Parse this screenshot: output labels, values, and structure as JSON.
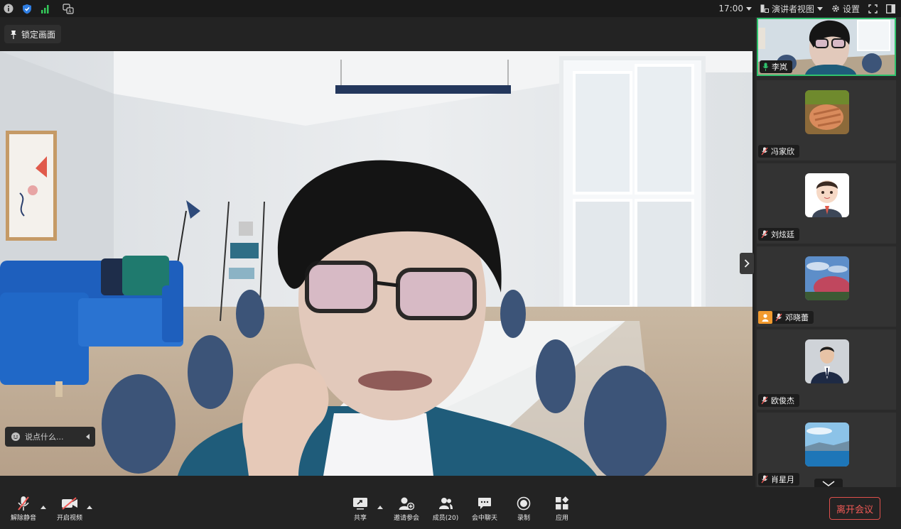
{
  "topbar": {
    "time": "17:00",
    "view_mode": "演讲者视图",
    "settings_label": "设置",
    "icons": [
      "info-icon",
      "shield-icon",
      "signal-icon",
      "translate-icon"
    ]
  },
  "lock_chip": {
    "label": "锁定画面"
  },
  "chat": {
    "placeholder": "说点什么..."
  },
  "participants": [
    {
      "name": "李岚",
      "active": true,
      "mic": "on"
    },
    {
      "name": "冯家欣",
      "mic": "muted"
    },
    {
      "name": "刘炫廷",
      "mic": "muted"
    },
    {
      "name": "邓晓蕾",
      "mic": "muted",
      "host": true
    },
    {
      "name": "欧俊杰",
      "mic": "muted"
    },
    {
      "name": "肖星月",
      "mic": "muted"
    }
  ],
  "toolbar": {
    "unmute": "解除静音",
    "start_video": "开启视频",
    "share": "共享",
    "invite": "邀请参会",
    "members": "成员(20)",
    "chat": "会中聊天",
    "record": "录制",
    "apps": "应用",
    "leave": "离开会议"
  },
  "colors": {
    "active_border": "#2fc36d",
    "leave_red": "#f25a56",
    "host_orange": "#f29a2e",
    "mic_on_green": "#2fc36d"
  }
}
